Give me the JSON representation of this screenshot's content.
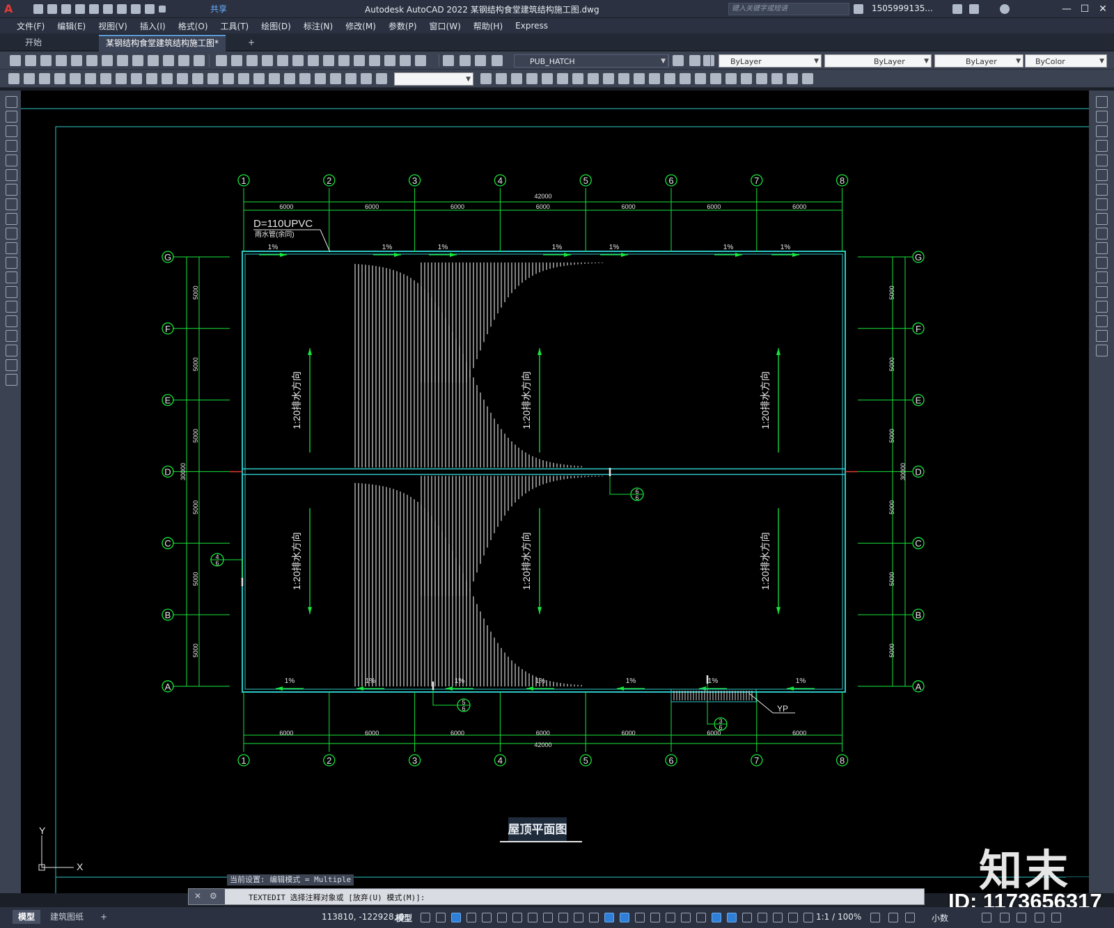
{
  "titlebar": {
    "logo": "A",
    "share_label": "共享",
    "app_title": "Autodesk AutoCAD 2022    某钢结构食堂建筑结构施工图.dwg",
    "search_placeholder": "键入关键字或短语",
    "user": "1505999135...",
    "win_min": "—",
    "win_max": "☐",
    "win_close": "✕"
  },
  "menu": [
    "文件(F)",
    "编辑(E)",
    "视图(V)",
    "插入(I)",
    "格式(O)",
    "工具(T)",
    "绘图(D)",
    "标注(N)",
    "修改(M)",
    "参数(P)",
    "窗口(W)",
    "帮助(H)",
    "Express"
  ],
  "tabs": {
    "start": "开始",
    "drawing": "某钢结构食堂建筑结构施工图*",
    "add": "+"
  },
  "properties": {
    "layer": "PUB_HATCH",
    "color": "ByLayer",
    "linetype": "ByLayer",
    "lineweight": "ByLayer",
    "plotstyle": "ByColor"
  },
  "drawing": {
    "top_grid": [
      "1",
      "2",
      "3",
      "4",
      "5",
      "6",
      "7",
      "8"
    ],
    "side_grid": [
      "G",
      "F",
      "E",
      "D",
      "C",
      "B",
      "A"
    ],
    "bay_dim": "6000",
    "total_width": "42000",
    "row_dim": "5000",
    "total_depth": "30000",
    "pipe_note": "D=110UPVC",
    "pipe_sub": "雨水管(余同)",
    "slope": "1%",
    "drain_label": "1:20排水方向",
    "yp_label": "YP",
    "title": "屋顶平面图",
    "detail_callouts": [
      {
        "num": "6",
        "sheet": "6"
      },
      {
        "num": "4",
        "sheet": "6"
      },
      {
        "num": "5",
        "sheet": "6"
      },
      {
        "num": "3",
        "sheet": "6"
      }
    ],
    "ucs_x": "X",
    "ucs_y": "Y"
  },
  "command": {
    "history": "当前设置: 编辑模式 = Multiple",
    "prompt": "TEXTEDIT 选择注释对象或 [放弃(U) 模式(M)]:"
  },
  "status": {
    "model_tab": "模型",
    "layout_tab": "建筑图纸",
    "add": "+",
    "coords": "113810, -122928, 0",
    "model": "模型",
    "scale": "1:1 / 100%",
    "units": "小数"
  },
  "watermark": {
    "logo": "知末",
    "id": "ID: 1173656317"
  }
}
